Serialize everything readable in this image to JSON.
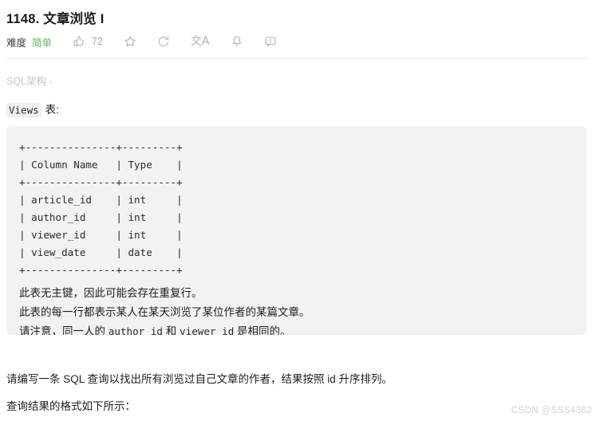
{
  "header": {
    "title": "1148. 文章浏览 I"
  },
  "meta": {
    "difficulty_label": "难度",
    "difficulty_value": "简单",
    "difficulty_color": "#5cb85c",
    "like_count": "72",
    "tools": [
      {
        "icon": "thumbs-up-icon",
        "label": "72"
      },
      {
        "icon": "star-icon",
        "label": ""
      },
      {
        "icon": "share-refresh-icon",
        "label": ""
      },
      {
        "icon": "translate-icon",
        "label": "文A"
      },
      {
        "icon": "bell-icon",
        "label": ""
      },
      {
        "icon": "comment-icon",
        "label": ""
      }
    ]
  },
  "schema": {
    "link_text": "SQL架构",
    "chevron": "›"
  },
  "table_intro": {
    "code": "Views",
    "suffix": "表:"
  },
  "code_block": {
    "ascii_table": "+---------------+---------+\n| Column Name   | Type    |\n+---------------+---------+\n| article_id    | int     |\n| author_id     | int     |\n| viewer_id     | int     |\n| view_date     | date    |\n+---------------+---------+",
    "notes": [
      {
        "text": "此表无主键，因此可能会存在重复行。"
      },
      {
        "text": "此表的每一行都表示某人在某天浏览了某位作者的某篇文章。"
      }
    ],
    "note_with_code": {
      "prefix": "请注意，同一人的 ",
      "code1": "author_id",
      "middle": " 和 ",
      "code2": "viewer_id",
      "suffix": " 是相同的。"
    }
  },
  "body": {
    "paragraph_1": "请编写一条 SQL 查询以找出所有浏览过自己文章的作者，结果按照 id 升序排列。",
    "paragraph_2": "查询结果的格式如下所示："
  },
  "watermark": {
    "text": "CSDN @SSS4362"
  }
}
